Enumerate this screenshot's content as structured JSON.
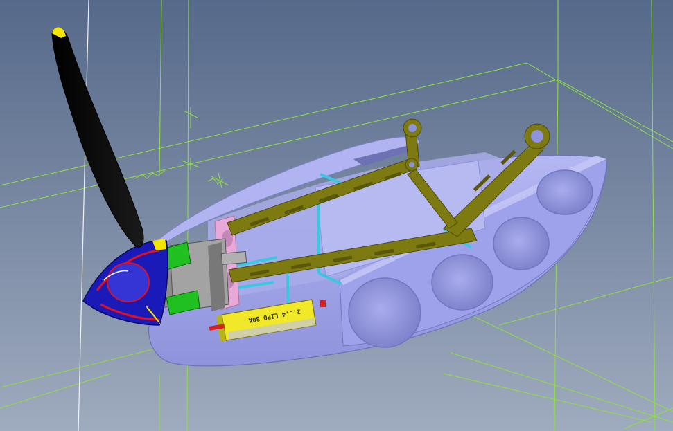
{
  "viewport": {
    "background_top": "#56698a",
    "background_bottom": "#9fabbe",
    "grid_color": "#8fe03a",
    "reference_line_color": "#f2f2f2"
  },
  "model": {
    "fuselage_color": "#9a9ee8",
    "frame_color": "#7d7a12",
    "propeller_color": "#050505",
    "propeller_tip_color": "#f5e600",
    "spinner_color": "#1a1ab8",
    "spinner_accent_color": "#e01020",
    "motor_mount_color": "#9a9a9a",
    "bulkhead_color": "#e8a8d8",
    "stiffener_color": "#38c8e0",
    "motor_color": "#20c020",
    "battery": {
      "body_color": "#f0e828",
      "label": "2...4 LIPO 30A",
      "connector_color": "#d82020"
    }
  }
}
